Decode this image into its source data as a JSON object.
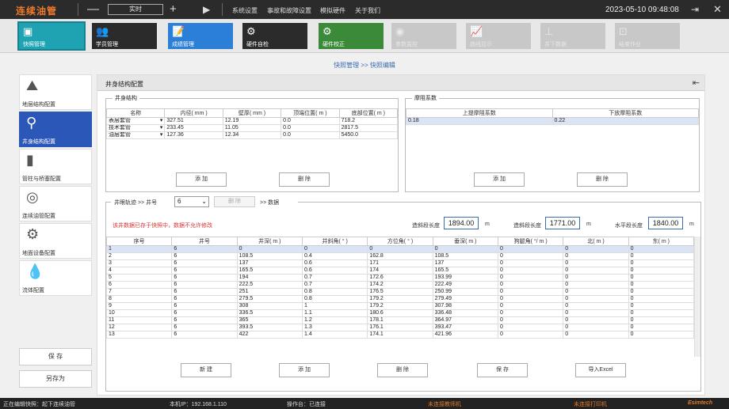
{
  "titlebar": {
    "logo": "连续油管",
    "minus": "—",
    "mode": "实时",
    "plus": "+",
    "play": "▶",
    "menus": [
      "系统设置",
      "事故和故障设置",
      "模拟硬件",
      "关于我们"
    ],
    "datetime": "2023-05-10  09:48:08"
  },
  "toolbar": [
    {
      "label": "快照管理",
      "icon": "camera-icon",
      "glyph": "▣",
      "color": "#1fa3b3",
      "disabled": false
    },
    {
      "label": "学员管理",
      "icon": "users-icon",
      "glyph": "👥",
      "color": "#2b2b2b",
      "disabled": false
    },
    {
      "label": "成绩管理",
      "icon": "report-icon",
      "glyph": "📝",
      "color": "#2b7fd6",
      "disabled": false
    },
    {
      "label": "硬件自检",
      "icon": "gear-icon",
      "glyph": "⚙",
      "color": "#2b2b2b",
      "disabled": false
    },
    {
      "label": "硬件校正",
      "icon": "gear-icon",
      "glyph": "⚙",
      "color": "#3a8a3a",
      "disabled": false
    },
    {
      "label": "参数监控",
      "icon": "eye-icon",
      "glyph": "◉",
      "color": "#c8c8c8",
      "disabled": true
    },
    {
      "label": "曲线显示",
      "icon": "chart-icon",
      "glyph": "📈",
      "color": "#c8c8c8",
      "disabled": true
    },
    {
      "label": "井下数据",
      "icon": "well-icon",
      "glyph": "⊥",
      "color": "#c8c8c8",
      "disabled": true
    },
    {
      "label": "结束作业",
      "icon": "stop-icon",
      "glyph": "⊡",
      "color": "#c8c8c8",
      "disabled": true
    }
  ],
  "breadcrumb": "快照管理 >> 快照编辑",
  "sidebar": {
    "items": [
      {
        "label": "地层结构配置",
        "glyph": "⛰"
      },
      {
        "label": "井身结构配置",
        "glyph": "⚲"
      },
      {
        "label": "管柱与桥塞配置",
        "glyph": "▮"
      },
      {
        "label": "连续油管配置",
        "glyph": "◎"
      },
      {
        "label": "地面设备配置",
        "glyph": "⚙"
      },
      {
        "label": "流体配置",
        "glyph": "💧"
      }
    ],
    "save": "保 存",
    "save_as": "另存为"
  },
  "panel": {
    "title": "井身结构配置"
  },
  "structure": {
    "legend": "井身结构",
    "headers": [
      "名称",
      "内径( mm )",
      "壁厚( mm )",
      "顶端位置( m )",
      "底部位置( m )"
    ],
    "rows": [
      [
        "表层套管",
        "327.51",
        "12.19",
        "0.0",
        "718.2"
      ],
      [
        "技术套管",
        "233.45",
        "11.05",
        "0.0",
        "2817.5"
      ],
      [
        "油层套管",
        "127.36",
        "12.34",
        "0.0",
        "5450.0"
      ]
    ],
    "add": "添 加",
    "del": "删 除"
  },
  "friction": {
    "legend": "摩阻系数",
    "headers": [
      "上提摩阻系数",
      "下放摩阻系数"
    ],
    "rows": [
      [
        "0.18",
        "0.22"
      ]
    ],
    "add": "添 加",
    "del": "删 除"
  },
  "trajectory": {
    "legend_a": "井眼轨迹 >> 井号",
    "well": "6",
    "del_label": "删 除",
    "legend_b": ">> 数据",
    "warning": "该井数据已存于快照中，数据不允许修改",
    "kick_label": "造斜段长度",
    "kick_value": "1894.00",
    "kick_unit": "m",
    "slant_label": "造斜段长度",
    "slant_value": "1771.00",
    "slant_unit": "m",
    "horiz_label": "水平段长度",
    "horiz_value": "1840.00",
    "horiz_unit": "m",
    "headers": [
      "序号",
      "井号",
      "井深( m )",
      "井斜角( ° )",
      "方位角( ° )",
      "垂深( m )",
      "狗腿角( °/ m )",
      "北( m )",
      "东( m )"
    ],
    "rows": [
      [
        "1",
        "6",
        "0",
        "0",
        "0",
        "0",
        "0",
        "0",
        "0"
      ],
      [
        "2",
        "6",
        "108.5",
        "0.4",
        "162.8",
        "108.5",
        "0",
        "0",
        "0"
      ],
      [
        "3",
        "6",
        "137",
        "0.6",
        "171",
        "137",
        "0",
        "0",
        "0"
      ],
      [
        "4",
        "6",
        "165.5",
        "0.6",
        "174",
        "165.5",
        "0",
        "0",
        "0"
      ],
      [
        "5",
        "6",
        "194",
        "0.7",
        "172.6",
        "193.99",
        "0",
        "0",
        "0"
      ],
      [
        "6",
        "6",
        "222.5",
        "0.7",
        "174.2",
        "222.49",
        "0",
        "0",
        "0"
      ],
      [
        "7",
        "6",
        "251",
        "0.8",
        "176.5",
        "250.99",
        "0",
        "0",
        "0"
      ],
      [
        "8",
        "6",
        "279.5",
        "0.8",
        "179.2",
        "279.49",
        "0",
        "0",
        "0"
      ],
      [
        "9",
        "6",
        "308",
        "1",
        "179.2",
        "307.98",
        "0",
        "0",
        "0"
      ],
      [
        "10",
        "6",
        "336.5",
        "1.1",
        "180.6",
        "336.48",
        "0",
        "0",
        "0"
      ],
      [
        "11",
        "6",
        "365",
        "1.2",
        "178.1",
        "364.97",
        "0",
        "0",
        "0"
      ],
      [
        "12",
        "6",
        "393.5",
        "1.3",
        "176.1",
        "393.47",
        "0",
        "0",
        "0"
      ],
      [
        "13",
        "6",
        "422",
        "1.4",
        "174.1",
        "421.96",
        "0",
        "0",
        "0"
      ]
    ],
    "buttons": [
      "新 建",
      "添 加",
      "删 除",
      "保 存",
      "导入Excel"
    ]
  },
  "status": {
    "editing": "正在编辑快照：起下连续油管",
    "ip": "本机IP：192.168.1.110",
    "console": "操作台：已连接",
    "warn1": "未连接教师机",
    "warn2": "未连接打印机",
    "brand": "Esimtech"
  }
}
